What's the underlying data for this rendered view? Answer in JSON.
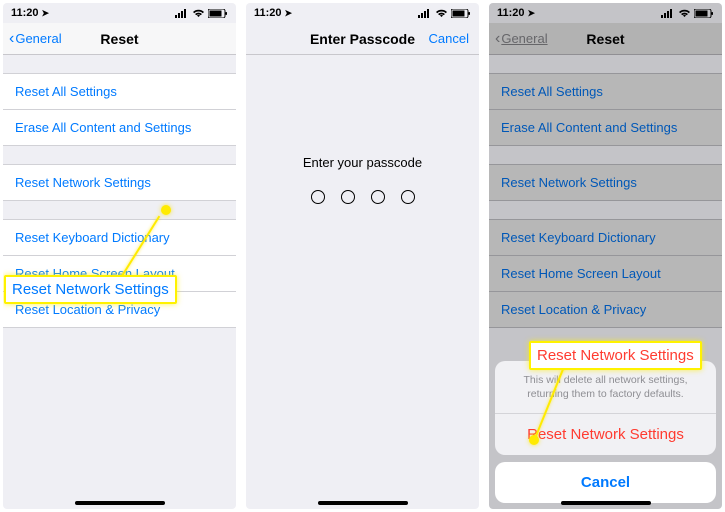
{
  "status": {
    "time": "11:20"
  },
  "screen1": {
    "back": "General",
    "title": "Reset",
    "groups": [
      [
        "Reset All Settings",
        "Erase All Content and Settings"
      ],
      [
        "Reset Network Settings"
      ],
      [
        "Reset Keyboard Dictionary",
        "Reset Home Screen Layout",
        "Reset Location & Privacy"
      ]
    ],
    "callout": "Reset Network Settings"
  },
  "screen2": {
    "title": "Enter Passcode",
    "cancel": "Cancel",
    "prompt": "Enter your passcode"
  },
  "screen3": {
    "back": "General",
    "title": "Reset",
    "groups": [
      [
        "Reset All Settings",
        "Erase All Content and Settings"
      ],
      [
        "Reset Network Settings"
      ],
      [
        "Reset Keyboard Dictionary",
        "Reset Home Screen Layout",
        "Reset Location & Privacy"
      ]
    ],
    "sheet": {
      "message": "This will delete all network settings, returning them to factory defaults.",
      "destructive": "Reset Network Settings",
      "cancel": "Cancel"
    },
    "callout": "Reset Network Settings"
  }
}
